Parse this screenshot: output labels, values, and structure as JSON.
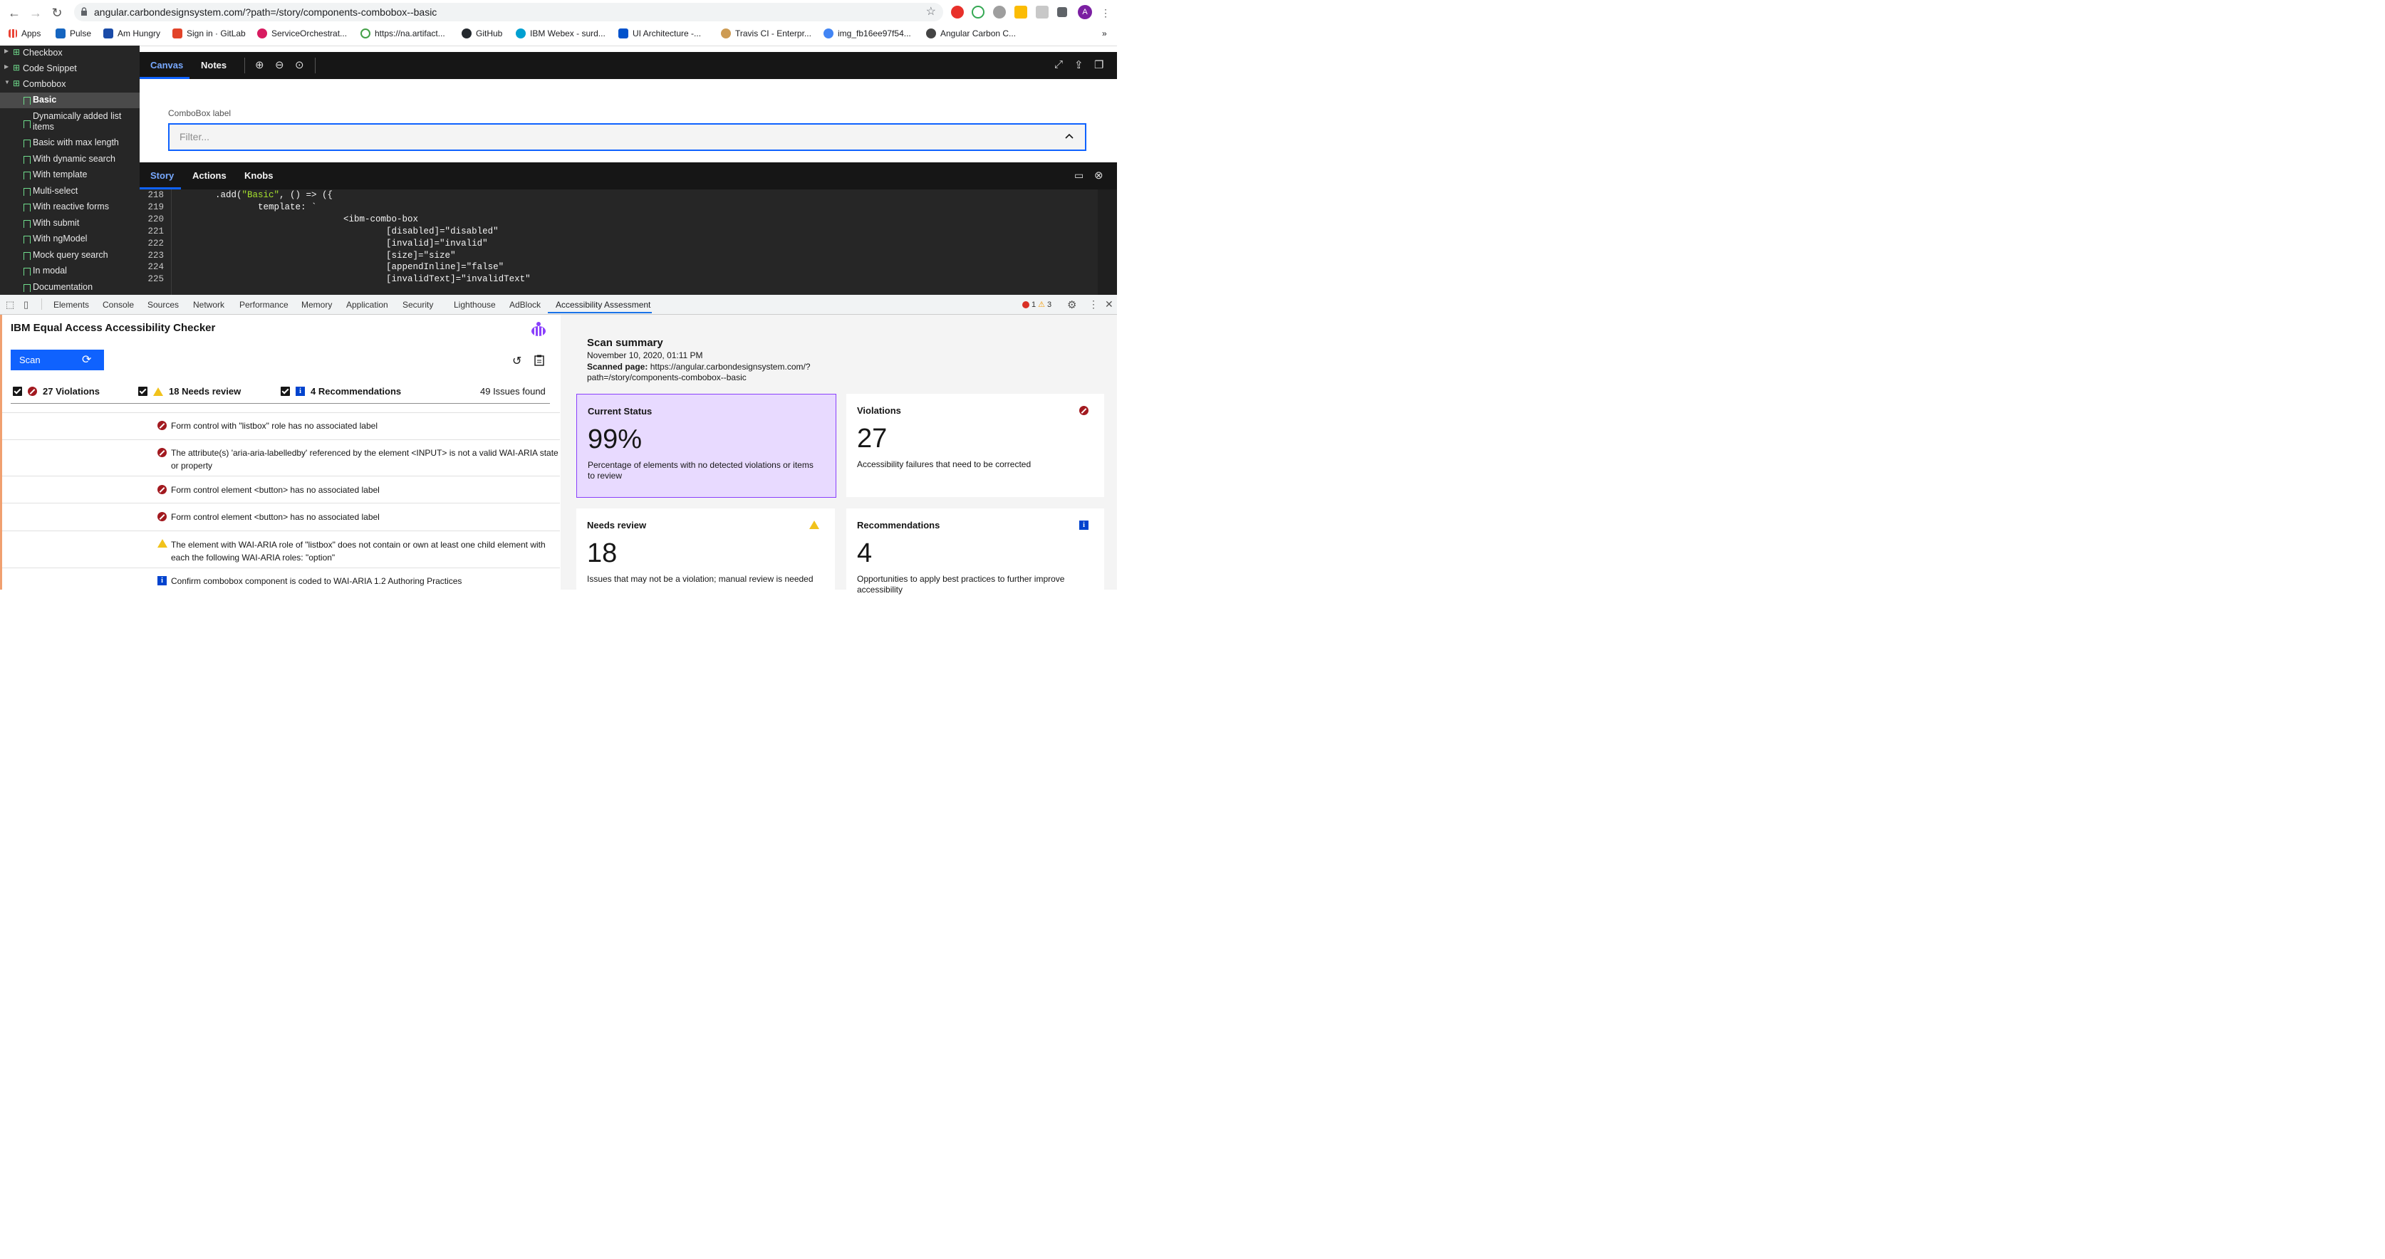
{
  "browser": {
    "url": "angular.carbondesignsystem.com/?path=/story/components-combobox--basic",
    "bookmarks": [
      "Apps",
      "Pulse",
      "Am Hungry",
      "Sign in · GitLab",
      "ServiceOrchestrat...",
      "https://na.artifact...",
      "GitHub",
      "IBM Webex - surd...",
      "UI Architecture -...",
      "Travis CI - Enterpr...",
      "img_fb16ee97f54...",
      "Angular Carbon C..."
    ],
    "avatar_letter": "A",
    "more": "»"
  },
  "sidebar": {
    "groups": [
      {
        "label": "Checkbox"
      },
      {
        "label": "Code Snippet"
      },
      {
        "label": "Combobox"
      }
    ],
    "items": [
      {
        "label": "Basic"
      },
      {
        "label": "Dynamically added list"
      },
      {
        "label": "items"
      },
      {
        "label": "Basic with max length"
      },
      {
        "label": "With dynamic search"
      },
      {
        "label": "With template"
      },
      {
        "label": "Multi-select"
      },
      {
        "label": "With reactive forms"
      },
      {
        "label": "With submit"
      },
      {
        "label": "With ngModel"
      },
      {
        "label": "Mock query search"
      },
      {
        "label": "In modal"
      },
      {
        "label": "Documentation"
      }
    ]
  },
  "canvas": {
    "tabs": [
      "Canvas",
      "Notes"
    ],
    "combo_label": "ComboBox label",
    "combo_placeholder": "Filter..."
  },
  "story": {
    "tabs": [
      "Story",
      "Actions",
      "Knobs"
    ],
    "lines": [
      {
        "n": "218",
        "pre": "        .add(",
        "str": "\"Basic\"",
        "post": ", () => ({"
      },
      {
        "n": "219",
        "pre": "                template: `",
        "str": "",
        "post": ""
      },
      {
        "n": "220",
        "pre": "                                <ibm-combo-box",
        "str": "",
        "post": ""
      },
      {
        "n": "221",
        "pre": "                                        [disabled]=\"disabled\"",
        "str": "",
        "post": ""
      },
      {
        "n": "222",
        "pre": "                                        [invalid]=\"invalid\"",
        "str": "",
        "post": ""
      },
      {
        "n": "223",
        "pre": "                                        [size]=\"size\"",
        "str": "",
        "post": ""
      },
      {
        "n": "224",
        "pre": "                                        [appendInline]=\"false\"",
        "str": "",
        "post": ""
      },
      {
        "n": "225",
        "pre": "                                        [invalidText]=\"invalidText\"",
        "str": "",
        "post": ""
      }
    ]
  },
  "devtools": {
    "tabs": [
      "Elements",
      "Console",
      "Sources",
      "Network",
      "Performance",
      "Memory",
      "Application",
      "Security",
      "Lighthouse",
      "AdBlock",
      "Accessibility Assessment"
    ],
    "error_count": "1",
    "warning_count": "3"
  },
  "checker": {
    "title": "IBM Equal Access Accessibility Checker",
    "scan_label": "Scan",
    "filters": {
      "violations": "27 Violations",
      "needs_review": "18 Needs review",
      "recommendations": "4 Recommendations",
      "total": "49 Issues found"
    },
    "issues": [
      {
        "type": "violation",
        "text": "Form control with \"listbox\" role has no associated label"
      },
      {
        "type": "violation",
        "text": "The attribute(s) 'aria-aria-labelledby' referenced by the element <INPUT> is not a valid WAI-ARIA state or property"
      },
      {
        "type": "violation",
        "text": "Form control element <button> has no associated label"
      },
      {
        "type": "violation",
        "text": "Form control element <button> has no associated label"
      },
      {
        "type": "review",
        "text": "The element with WAI-ARIA role of \"listbox\" does not contain or own at least one child element with each the following WAI-ARIA roles: \"option\""
      },
      {
        "type": "recommendation",
        "text": "Confirm combobox component is coded to WAI-ARIA 1.2 Authoring Practices"
      }
    ]
  },
  "summary": {
    "title": "Scan summary",
    "date": "November 10, 2020, 01:11 PM",
    "scanned_label": "Scanned page:",
    "scanned_url_1": "https://angular.carbondesignsystem.com/?",
    "scanned_url_2": "path=/story/components-combobox--basic",
    "cards": {
      "status": {
        "title": "Current Status",
        "value": "99%",
        "desc": "Percentage of elements with no detected violations or items to review"
      },
      "violations": {
        "title": "Violations",
        "value": "27",
        "desc": "Accessibility failures that need to be corrected"
      },
      "needs_review": {
        "title": "Needs review",
        "value": "18",
        "desc": "Issues that may not be a violation; manual review is needed"
      },
      "recommendations": {
        "title": "Recommendations",
        "value": "4",
        "desc": "Opportunities to apply best practices to further improve accessibility"
      }
    }
  },
  "colors": {
    "accent": "#0f62fe",
    "violation": "#a2191f",
    "warning": "#f1c21b",
    "info": "#0043ce",
    "status_card_bg": "#e8daff",
    "status_card_border": "#8a3ffc"
  }
}
